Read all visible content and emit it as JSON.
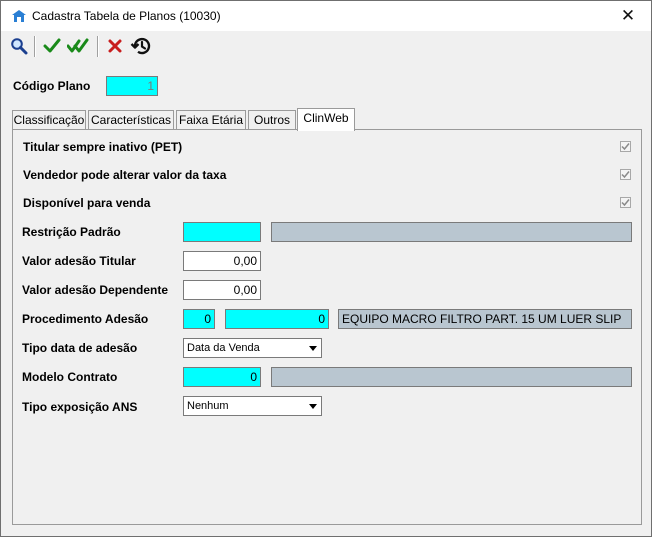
{
  "window": {
    "title": "Cadastra Tabela de Planos (10030)"
  },
  "toolbar": {
    "search_icon": "search-icon",
    "confirm_icon": "check-icon",
    "confirm_all_icon": "double-check-icon",
    "cancel_icon": "x-icon",
    "history_icon": "history-icon"
  },
  "header": {
    "codigo_plano_label": "Código Plano",
    "codigo_plano_value": "1"
  },
  "tabs": [
    {
      "label": "Classificação",
      "active": false
    },
    {
      "label": "Características",
      "active": false
    },
    {
      "label": "Faixa Etária",
      "active": false
    },
    {
      "label": "Outros",
      "active": false
    },
    {
      "label": "ClinWeb",
      "active": true
    }
  ],
  "panel": {
    "checkboxes": [
      {
        "label": "Titular sempre inativo (PET)",
        "checked": true
      },
      {
        "label": "Vendedor pode alterar valor da taxa",
        "checked": true
      },
      {
        "label": "Disponível para venda",
        "checked": true
      }
    ],
    "restricao_padrao_label": "Restrição Padrão",
    "restricao_padrao_code": "",
    "restricao_padrao_desc": "",
    "valor_adesao_titular_label": "Valor adesão Titular",
    "valor_adesao_titular_value": "0,00",
    "valor_adesao_dependente_label": "Valor adesão Dependente",
    "valor_adesao_dependente_value": "0,00",
    "procedimento_adesao_label": "Procedimento Adesão",
    "procedimento_adesao_code1": "0",
    "procedimento_adesao_code2": "0",
    "procedimento_adesao_desc": "EQUIPO MACRO FILTRO PART. 15 UM LUER SLIP",
    "tipo_data_adesao_label": "Tipo data de adesão",
    "tipo_data_adesao_value": "Data da Venda",
    "modelo_contrato_label": "Modelo Contrato",
    "modelo_contrato_code": "0",
    "modelo_contrato_desc": "",
    "tipo_exposicao_ans_label": "Tipo exposição ANS",
    "tipo_exposicao_ans_value": "Nenhum"
  },
  "colors": {
    "required_field": "#00ffff",
    "readonly_field": "#b9c6d0",
    "check_green": "#1a8a1a",
    "cancel_red": "#c81e1e"
  }
}
